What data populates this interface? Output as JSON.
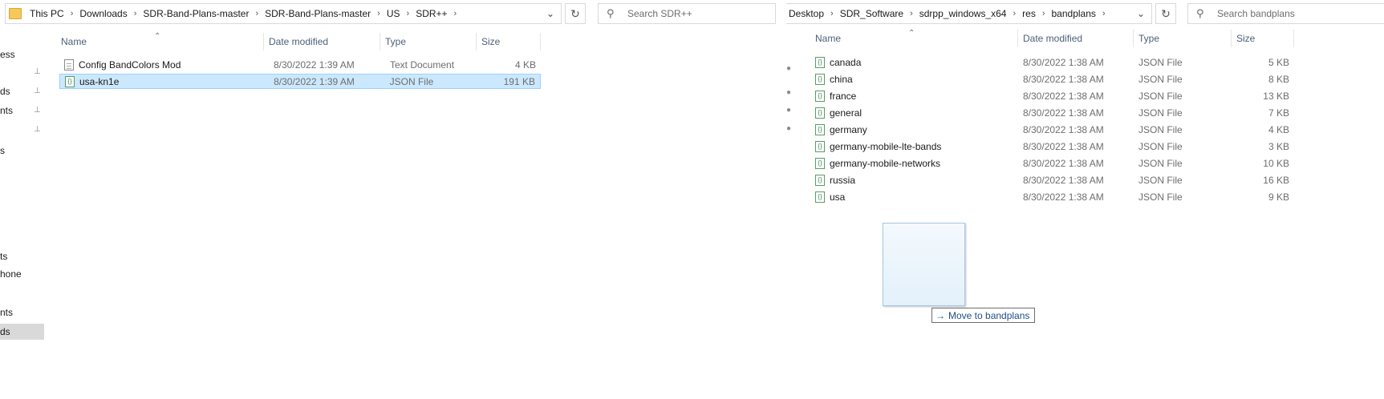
{
  "left": {
    "breadcrumb": [
      "This PC",
      "Downloads",
      "SDR-Band-Plans-master",
      "SDR-Band-Plans-master",
      "US",
      "SDR++"
    ],
    "search_placeholder": "Search SDR++",
    "nav_fragments": [
      "ess",
      "ds",
      "nts",
      "s",
      "ts",
      "hone",
      "nts",
      "ds"
    ],
    "columns": {
      "name": "Name",
      "date": "Date modified",
      "type": "Type",
      "size": "Size"
    },
    "files": [
      {
        "name": "Config BandColors Mod",
        "date": "8/30/2022 1:39 AM",
        "type": "Text Document",
        "size": "4 KB",
        "icon": "text-file-icon",
        "selected": false
      },
      {
        "name": "usa-kn1e",
        "date": "8/30/2022 1:39 AM",
        "type": "JSON File",
        "size": "191 KB",
        "icon": "json-file-icon",
        "selected": true
      }
    ]
  },
  "right": {
    "breadcrumb": [
      "Desktop",
      "SDR_Software",
      "sdrpp_windows_x64",
      "res",
      "bandplans"
    ],
    "search_placeholder": "Search bandplans",
    "columns": {
      "name": "Name",
      "date": "Date modified",
      "type": "Type",
      "size": "Size"
    },
    "files": [
      {
        "name": "canada",
        "date": "8/30/2022 1:38 AM",
        "type": "JSON File",
        "size": "5 KB"
      },
      {
        "name": "china",
        "date": "8/30/2022 1:38 AM",
        "type": "JSON File",
        "size": "8 KB"
      },
      {
        "name": "france",
        "date": "8/30/2022 1:38 AM",
        "type": "JSON File",
        "size": "13 KB"
      },
      {
        "name": "general",
        "date": "8/30/2022 1:38 AM",
        "type": "JSON File",
        "size": "7 KB"
      },
      {
        "name": "germany",
        "date": "8/30/2022 1:38 AM",
        "type": "JSON File",
        "size": "4 KB"
      },
      {
        "name": "germany-mobile-lte-bands",
        "date": "8/30/2022 1:38 AM",
        "type": "JSON File",
        "size": "3 KB"
      },
      {
        "name": "germany-mobile-networks",
        "date": "8/30/2022 1:38 AM",
        "type": "JSON File",
        "size": "10 KB"
      },
      {
        "name": "russia",
        "date": "8/30/2022 1:38 AM",
        "type": "JSON File",
        "size": "16 KB"
      },
      {
        "name": "usa",
        "date": "8/30/2022 1:38 AM",
        "type": "JSON File",
        "size": "9 KB"
      }
    ]
  },
  "drag": {
    "tooltip": "Move to bandplans",
    "arrow": "→"
  },
  "icons": {
    "search": "search-icon",
    "refresh": "refresh-icon",
    "dropdown": "chevron-down-icon",
    "sort": "sort-up-icon",
    "pin": "pin-icon"
  },
  "colors": {
    "selection_bg": "#cce8ff",
    "selection_border": "#99d1ff",
    "header_text": "#4c607a",
    "folder": "#f6c85a",
    "tooltip_text": "#1f4e8c"
  }
}
